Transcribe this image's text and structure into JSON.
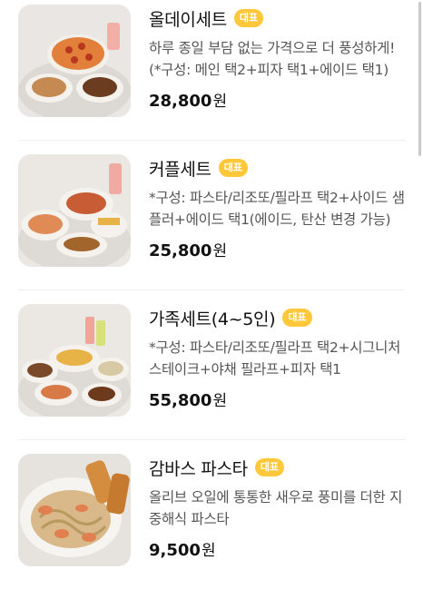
{
  "badge_label": "대표",
  "currency": "원",
  "menu_items": [
    {
      "name": "올데이세트",
      "description": "하루 종일 부담 없는 가격으로 더 풍성하게! (*구성: 메인 택2+피자 택1+에이드 택1)",
      "price": "28,800",
      "image": "set-meal-photo"
    },
    {
      "name": "커플세트",
      "description": "*구성: 파스타/리조또/필라프 택2+사이드 샘플러+에이드 택1(에이드, 탄산 변경 가능)",
      "price": "25,800",
      "image": "set-meal-photo"
    },
    {
      "name": "가족세트(4~5인)",
      "description": "*구성: 파스타/리조또/필라프 택2+시그니처 스테이크+야채 필라프+피자 택1",
      "price": "55,800",
      "image": "set-meal-photo"
    },
    {
      "name": "감바스 파스타",
      "description": "올리브 오일에 통통한 새우로 풍미를 더한 지중해식 파스타",
      "price": "9,500",
      "image": "pasta-photo"
    }
  ],
  "colors": {
    "badge": "#ffc73a",
    "divider": "#eeeeee",
    "description_text": "#555555"
  }
}
